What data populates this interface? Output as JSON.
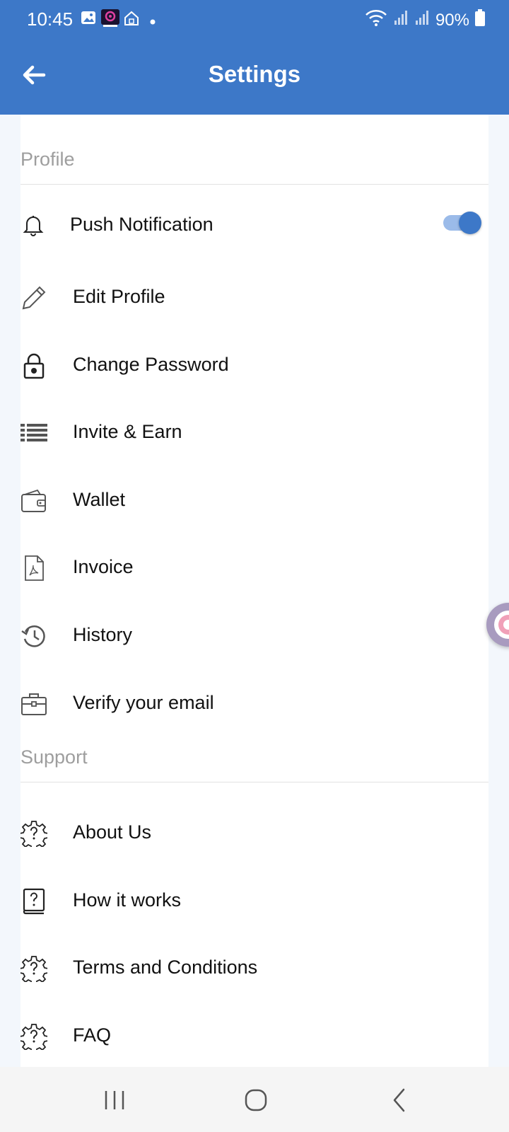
{
  "status_bar": {
    "time": "10:45",
    "battery": "90%",
    "icons": [
      "image-icon",
      "app-notification-icon",
      "home-icon",
      "dot-icon",
      "wifi-icon",
      "signal-icon",
      "signal-icon",
      "battery-icon"
    ]
  },
  "app_bar": {
    "title": "Settings",
    "back_icon": "arrow-left-icon"
  },
  "sections": {
    "profile": {
      "header": "Profile",
      "items": [
        {
          "label": "Push Notification",
          "icon": "bell-icon",
          "toggle": true
        },
        {
          "label": "Edit Profile",
          "icon": "pencil-icon"
        },
        {
          "label": "Change Password",
          "icon": "lock-icon"
        },
        {
          "label": "Invite & Earn",
          "icon": "list-icon"
        },
        {
          "label": "Wallet",
          "icon": "wallet-icon"
        },
        {
          "label": "Invoice",
          "icon": "pdf-document-icon"
        },
        {
          "label": "History",
          "icon": "history-icon"
        },
        {
          "label": "Verify your email",
          "icon": "briefcase-icon"
        }
      ]
    },
    "support": {
      "header": "Support",
      "items": [
        {
          "label": "About Us",
          "icon": "gear-question-icon"
        },
        {
          "label": "How it works",
          "icon": "book-question-icon"
        },
        {
          "label": "Terms and Conditions",
          "icon": "gear-question-icon"
        },
        {
          "label": "FAQ",
          "icon": "gear-question-icon"
        }
      ]
    }
  },
  "colors": {
    "primary": "#3d78c8",
    "toggle_track": "#9bbbe9",
    "section_header": "#9e9e9e"
  }
}
